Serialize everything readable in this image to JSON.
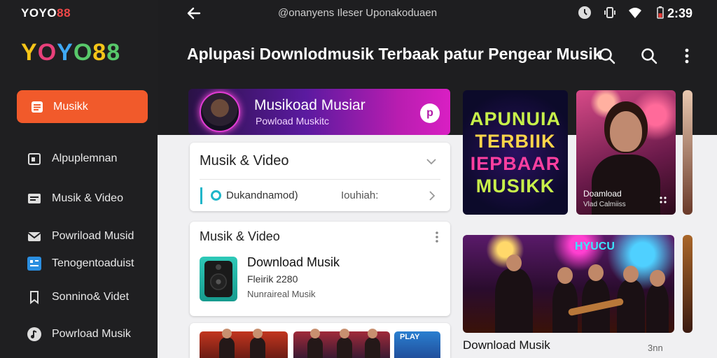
{
  "brand": {
    "small": "YOYO",
    "small_accent": "88",
    "big_letters": [
      "Y",
      "O",
      "Y",
      "O",
      "8",
      "8"
    ],
    "big_colors": [
      "#f5c518",
      "#e8407a",
      "#3fa9f5",
      "#58c86a",
      "#f5c518",
      "#58c86a"
    ]
  },
  "status": {
    "text": "@onanyens Ileser Uponakoduaen",
    "time": "2:39"
  },
  "sidebar": {
    "items": [
      {
        "label": "Musikk",
        "icon": "list-icon",
        "active": true
      },
      {
        "label": "Alpuplemnan",
        "icon": "app-icon"
      },
      {
        "label": "Musik & Video",
        "icon": "card-icon"
      },
      {
        "label": "Powriload Musid",
        "icon": "mail-icon"
      },
      {
        "label": "Tenogentoaduist",
        "icon": "grid-icon"
      },
      {
        "label": "Sonnino& Videt",
        "icon": "bookmark-icon"
      },
      {
        "label": "Powrload Musik",
        "icon": "music-note-icon"
      }
    ]
  },
  "header": {
    "title": "Aplupasi Downlodmusik Terbaak patur Pengear Musik"
  },
  "banner": {
    "title": "Musikoad Musiar",
    "subtitle": "Powload Muskitc",
    "play_glyph": "p"
  },
  "card1": {
    "title": "Musik & Video",
    "sub_left": "Dukandnamod)",
    "sub_right": "Iouhiah:"
  },
  "card2": {
    "title": "Musik & Video",
    "heading": "Download Musik",
    "line1": "Fleirik 2280",
    "line2": "Nunraireal Musik"
  },
  "card3": {
    "badge": "PLAY"
  },
  "poster": {
    "lines": [
      "APUNUIA",
      "TERBIIK",
      "IEPBAAR",
      "MUSIKK"
    ],
    "colors": [
      "#c8f04a",
      "#ffd54a",
      "#ff3fa0",
      "#c8f04a"
    ]
  },
  "singer": {
    "caption": "Doamload",
    "subcaption": "Vlad Calmiiss"
  },
  "concert": {
    "sign": "HYUCU",
    "caption": "Download Musik",
    "count": "3nn"
  },
  "colors": {
    "accent": "#f15a2b",
    "teal": "#1fb6c9"
  }
}
